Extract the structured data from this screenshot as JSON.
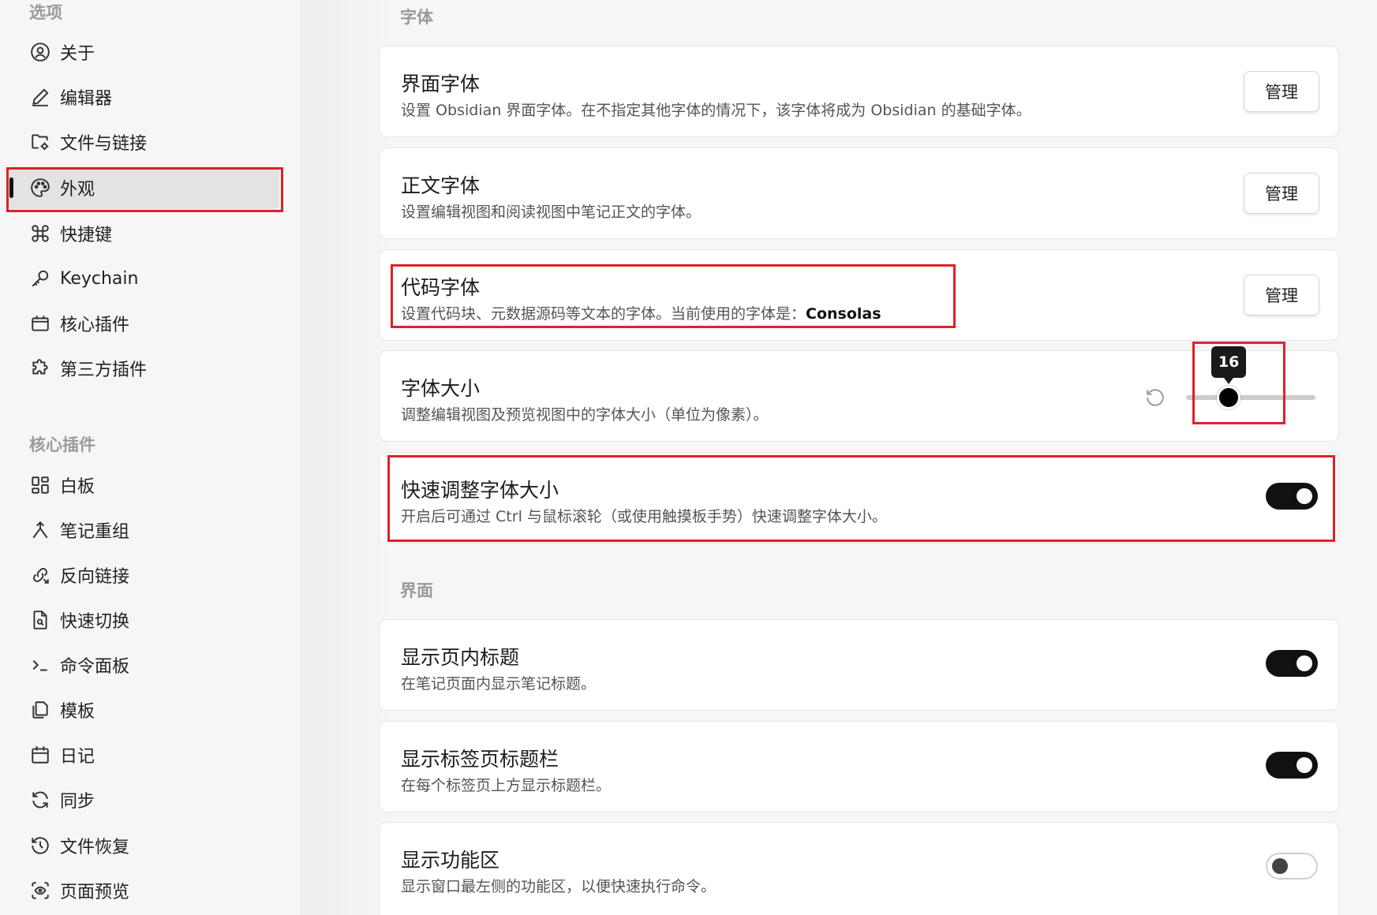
{
  "sidebar": {
    "options_header": "选项",
    "options_items": [
      {
        "label": "关于",
        "icon": "user-circle-icon"
      },
      {
        "label": "编辑器",
        "icon": "pen-icon"
      },
      {
        "label": "文件与链接",
        "icon": "folder-cog-icon"
      },
      {
        "label": "外观",
        "icon": "palette-icon",
        "active": true
      },
      {
        "label": "快捷键",
        "icon": "command-icon"
      },
      {
        "label": "Keychain",
        "icon": "key-icon"
      },
      {
        "label": "核心插件",
        "icon": "calendar-box-icon"
      },
      {
        "label": "第三方插件",
        "icon": "puzzle-icon"
      }
    ],
    "core_header": "核心插件",
    "core_items": [
      {
        "label": "白板",
        "icon": "layout-dashboard-icon"
      },
      {
        "label": "笔记重组",
        "icon": "merge-icon"
      },
      {
        "label": "反向链接",
        "icon": "backlink-icon"
      },
      {
        "label": "快速切换",
        "icon": "file-search-icon"
      },
      {
        "label": "命令面板",
        "icon": "terminal-icon"
      },
      {
        "label": "模板",
        "icon": "files-icon"
      },
      {
        "label": "日记",
        "icon": "calendar-icon"
      },
      {
        "label": "同步",
        "icon": "sync-icon"
      },
      {
        "label": "文件恢复",
        "icon": "history-icon"
      },
      {
        "label": "页面预览",
        "icon": "scan-eye-icon"
      }
    ]
  },
  "main": {
    "font_section": "字体",
    "interface_section": "界面",
    "manage_label": "管理",
    "settings": {
      "interface_font": {
        "name": "界面字体",
        "desc": "设置 Obsidian 界面字体。在不指定其他字体的情况下，该字体将成为 Obsidian 的基础字体。"
      },
      "text_font": {
        "name": "正文字体",
        "desc": "设置编辑视图和阅读视图中笔记正文的字体。"
      },
      "code_font": {
        "name": "代码字体",
        "desc": "设置代码块、元数据源码等文本的字体。当前使用的字体是：",
        "current": "Consolas"
      },
      "font_size": {
        "name": "字体大小",
        "desc": "调整编辑视图及预览视图中的字体大小（单位为像素）。",
        "value": "16",
        "value_fraction": 0.33
      },
      "quick_font_size": {
        "name": "快速调整字体大小",
        "desc": "开启后可通过 Ctrl 与鼠标滚轮（或使用触摸板手势）快速调整字体大小。",
        "enabled": true
      },
      "show_inline_title": {
        "name": "显示页内标题",
        "desc": "在笔记页面内显示笔记标题。",
        "enabled": true
      },
      "show_tab_title_bar": {
        "name": "显示标签页标题栏",
        "desc": "在每个标签页上方显示标题栏。",
        "enabled": true
      },
      "show_ribbon": {
        "name": "显示功能区",
        "desc": "显示窗口最左侧的功能区，以便快速执行命令。",
        "enabled": false
      }
    }
  },
  "colors": {
    "highlight": "#e0202a",
    "toggle_on": "#111111",
    "background": "#f6f6f6"
  }
}
